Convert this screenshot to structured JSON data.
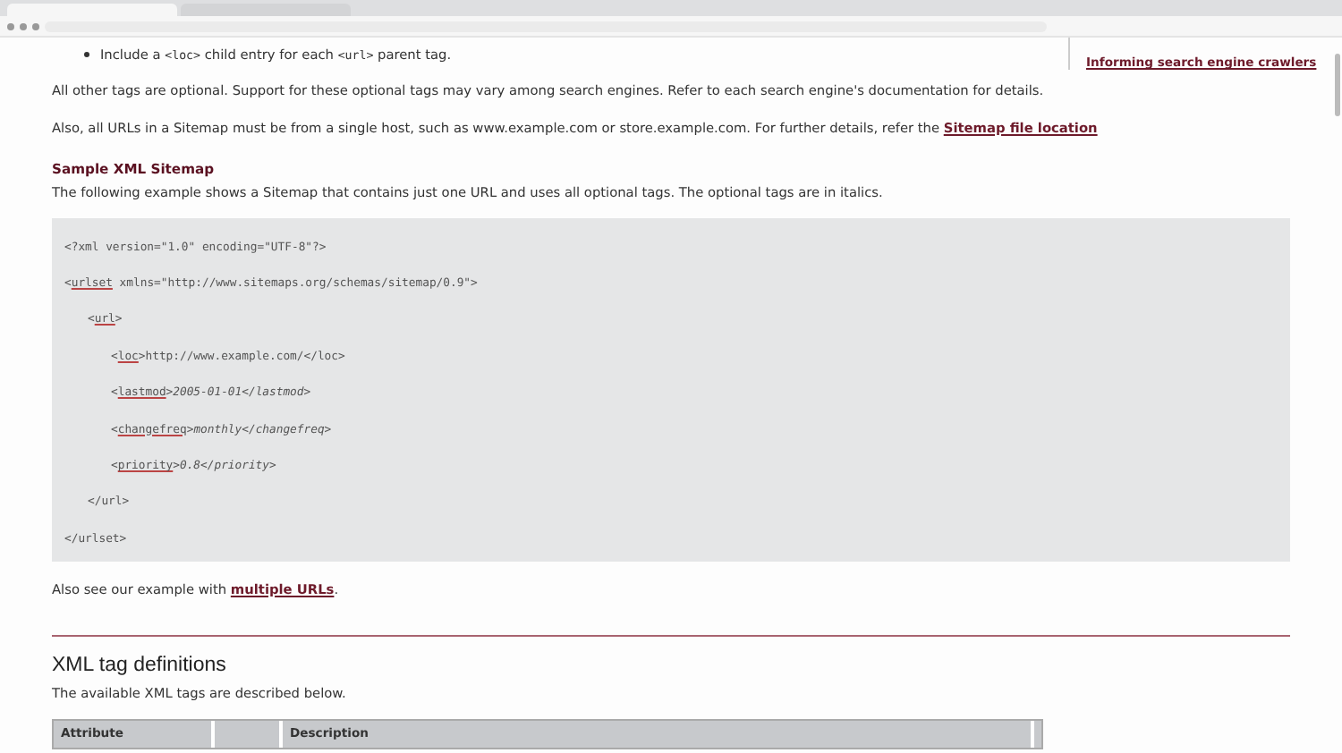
{
  "browser": {
    "tabs": [
      {
        "selected": true
      },
      {
        "selected": false
      }
    ]
  },
  "bullet": {
    "before": "Include a ",
    "tag": "<loc>",
    "middle": " child entry for each ",
    "tag2": "<url>",
    "after": " parent tag."
  },
  "sidebar": {
    "link": "Informing search engine crawlers"
  },
  "paragraphs": [
    "All other tags are optional. Support for these optional tags may vary among search engines. Refer to each search engine's documentation for details."
  ],
  "host_paragraph": {
    "text": "Also, all URLs in a Sitemap must be from a single host, such as www.example.com or store.example.com. For further details, refer the ",
    "link": "Sitemap file location"
  },
  "sample": {
    "heading": "Sample XML Sitemap",
    "intro": "The following example shows a Sitemap that contains just one URL and uses all optional tags. The optional tags are in italics.",
    "code": [
      {
        "text": "<?xml version=\"1.0\" encoding=\"UTF-8\"?>"
      },
      {
        "open": "<",
        "tag": "urlset",
        "rest": " xmlns=\"http://www.sitemaps.org/schemas/sitemap/0.9\">",
        "children": [
          {
            "open": "<",
            "tag": "url",
            "rest": ">",
            "children": [
              {
                "open": "<",
                "tag": "loc",
                "rest": ">http://www.example.com/</loc>",
                "italic": false
              },
              {
                "open": "<",
                "tag": "lastmod",
                "rest": ">2005-01-01</lastmod>",
                "italic": true
              },
              {
                "open": "<",
                "tag": "changefreq",
                "rest": ">monthly</changefreq>",
                "italic": true
              },
              {
                "open": "<",
                "tag": "priority",
                "rest": ">0.8</priority>",
                "italic": true
              }
            ]
          },
          {
            "text": "</url>"
          }
        ]
      },
      {
        "text": "</urlset>"
      }
    ]
  },
  "see_also": {
    "text": "Also see our example with ",
    "link": "multiple URLs",
    "after": "."
  },
  "section": {
    "heading": "XML tag definitions",
    "intro": "The available XML tags are described below.",
    "columns": [
      "Attribute",
      "",
      "Description"
    ]
  }
}
